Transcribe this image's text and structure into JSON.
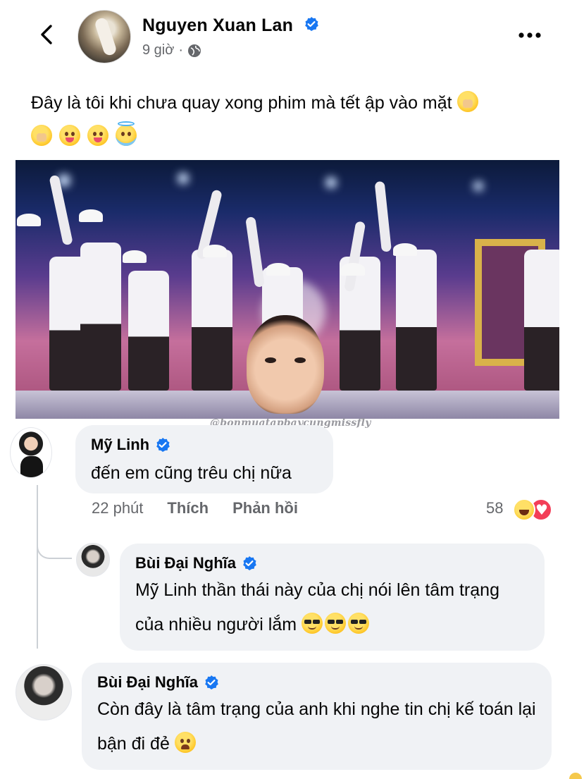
{
  "post": {
    "author": "Nguyen Xuan Lan",
    "time": "9 giờ",
    "separator": "·",
    "text": "Đây là tôi khi chưa quay xong phim mà tết ập vào mặt",
    "emojis": [
      "face-with-hand-over-mouth",
      "face-with-hand-over-mouth",
      "squinting-face-with-tongue",
      "squinting-face-with-tongue",
      "smiling-face-with-halo"
    ],
    "photo_watermark": "@bonmuatapbaycungmissfly"
  },
  "comments": [
    {
      "author": "Mỹ Linh",
      "text": "đến em cũng trêu chị nữa",
      "time": "22 phút",
      "like_label": "Thích",
      "reply_label": "Phản hồi",
      "reaction_count": "58",
      "reactions": [
        "haha",
        "love"
      ]
    },
    {
      "author": "Bùi Đại Nghĩa",
      "text": "Mỹ Linh thần thái này của chị nói lên tâm trạng của nhiều người lắm",
      "emojis": [
        "smiling-face-with-sunglasses",
        "smiling-face-with-sunglasses",
        "smiling-face-with-sunglasses"
      ]
    },
    {
      "author": "Bùi Đại Nghĩa",
      "text": "Còn đây là tâm trạng của anh khi nghe tin chị kế toán lại bận đi đẻ",
      "emojis": [
        "weary-face"
      ]
    }
  ],
  "colors": {
    "verified": "#1877f2",
    "bubble": "#f0f2f5",
    "secondary_text": "#65676b",
    "love": "#f33e58"
  }
}
